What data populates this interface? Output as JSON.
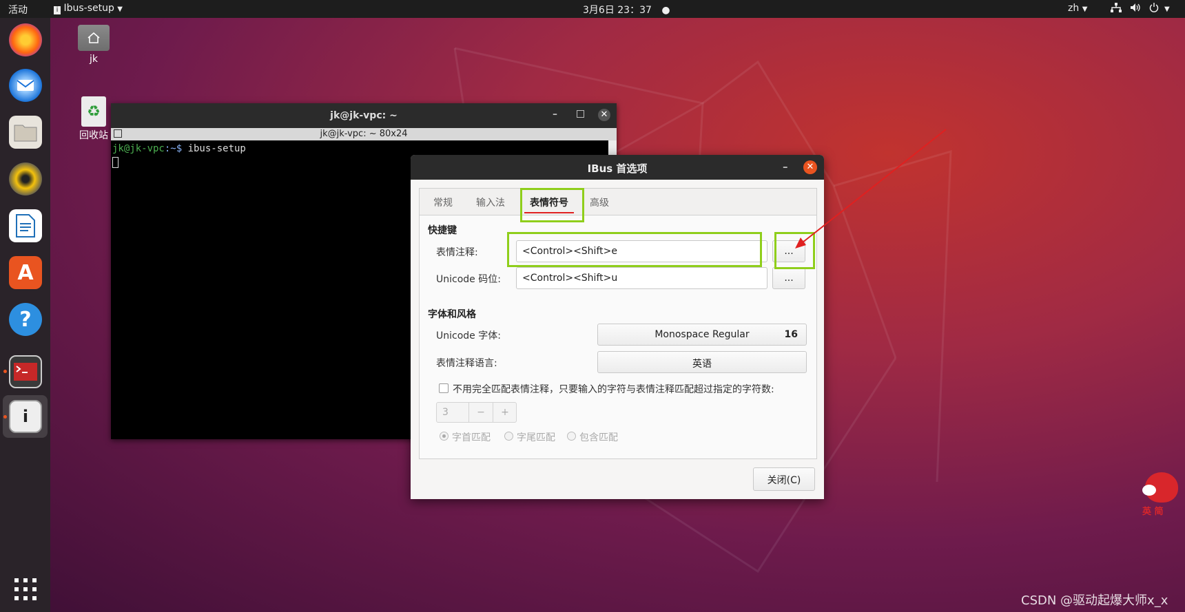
{
  "topbar": {
    "activities": "活动",
    "app_menu": "Ibus-setup",
    "clock": "3月6日  23：37",
    "lang": "zh"
  },
  "desktop": {
    "home_label": "jk",
    "trash_label": "回收站"
  },
  "terminal": {
    "title": "jk@jk-vpc: ~",
    "subtitle": "jk@jk-vpc: ~ 80x24",
    "prompt_user": "jk@jk-vpc",
    "prompt_path": ":~$ ",
    "command": "ibus-setup"
  },
  "dialog": {
    "title": "IBus 首选项",
    "tabs": [
      "常规",
      "输入法",
      "表情符号",
      "高级"
    ],
    "active_tab": "表情符号",
    "shortcuts_section": "快捷键",
    "emoji_annotation_label": "表情注释:",
    "emoji_annotation_value": "<Control><Shift>e",
    "unicode_label": "Unicode 码位:",
    "unicode_value": "<Control><Shift>u",
    "browse_label": "...",
    "font_section": "字体和风格",
    "unicode_font_label": "Unicode 字体:",
    "font_name": "Monospace Regular",
    "font_size": "16",
    "annotation_lang_label": "表情注释语言:",
    "annotation_lang_value": "英语",
    "partial_match_label": "不用完全匹配表情注释，只要输入的字符与表情注释匹配超过指定的字符数:",
    "spin_value": "3",
    "spin_minus": "−",
    "spin_plus": "+",
    "radio_prefix": "字首匹配",
    "radio_suffix": "字尾匹配",
    "radio_contains": "包含匹配",
    "close_button": "关闭(C)"
  },
  "watermark": "CSDN @驱动起爆大师x_x",
  "mascot_text": "英 简",
  "colors": {
    "accent": "#e95420",
    "highlight_green": "#8fce1b",
    "tab_underline": "#e02020",
    "arrow": "#e02020"
  }
}
